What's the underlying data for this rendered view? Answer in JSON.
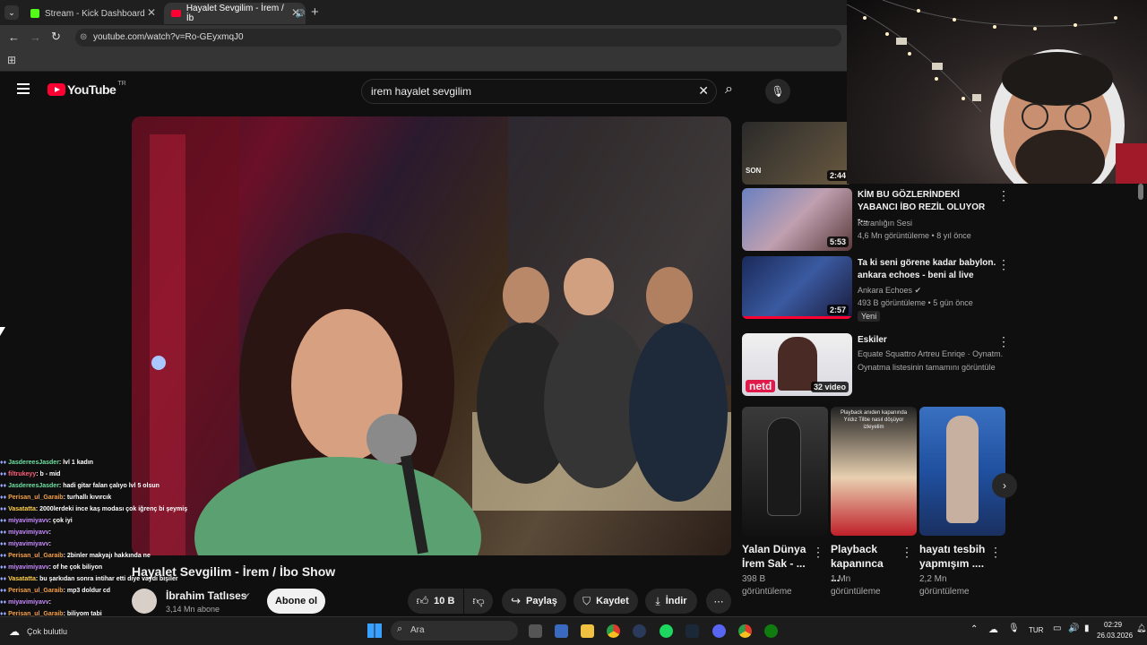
{
  "browser": {
    "tabs": [
      {
        "title": "Stream - Kick Dashboard"
      },
      {
        "title": "Hayalet Sevgilim - İrem / İb"
      }
    ],
    "url": "youtube.com/watch?v=Ro-GEyxmqJ0"
  },
  "youtube": {
    "logo": "YouTube",
    "region": "TR",
    "search_value": "irem hayalet sevgilim"
  },
  "video": {
    "title": "Hayalet Sevgilim - İrem / İbo Show",
    "channel": "İbrahim Tatlıses",
    "subscribers": "3,14 Mn abone",
    "subscribe_label": "Abone ol",
    "likes": "10 B",
    "share_label": "Paylaş",
    "save_label": "Kaydet",
    "download_label": "İndir"
  },
  "recommendations": [
    {
      "thumb_text": "SON",
      "duration": "2:44"
    },
    {
      "title": "KİM BU GÖZLERİNDEKİ YABANCI İBO REZİL OLUYOR -...",
      "channel": "Karanlığın Sesi",
      "meta": "4,6 Mn görüntüleme • 8 yıl önce",
      "duration": "5:53"
    },
    {
      "title": "Ta ki seni görene kadar babylon. ankara echoes - beni al live",
      "channel": "Ankara Echoes",
      "meta": "493 B görüntüleme • 5 gün önce",
      "badge": "Yeni",
      "duration": "2:57"
    },
    {
      "title": "Eskiler",
      "channel": "Equate Squattro Artreu Enriqe · Oynatm...",
      "meta": "Oynatma listesinin tamamını görüntüle",
      "duration": "32 video",
      "thumb_text": "netd"
    }
  ],
  "shorts": [
    {
      "title": "Yalan Dünya İrem Sak - ...",
      "views": "398 B görüntüleme"
    },
    {
      "title": "Playback kapanınca ...",
      "views": "1 Mn görüntüleme",
      "thumb_text": "Playback anıden kapanında Yıldız Tilbe nasıl döşüyor izleyelim"
    },
    {
      "title": "hayatı tesbih yapmışım ....",
      "views": "2,2 Mn görüntüleme"
    }
  ],
  "chat": [
    {
      "user": "JasdereesJasder",
      "msg": ": lvl 1 kadın",
      "color": "#6fe0a0"
    },
    {
      "user": "filtrukeyy",
      "msg": ": b - mid",
      "color": "#ff5d7a"
    },
    {
      "user": "JasdereesJasder",
      "msg": ": hadi gitar falan çalıyo lvl 5 olsun",
      "color": "#6fe0a0"
    },
    {
      "user": "Perisan_ul_Garaib",
      "msg": ": turhallı kıvırcık",
      "color": "#f5a04a"
    },
    {
      "user": "Vasatatta",
      "msg": ": 2000lerdeki ince kaş modası çok iğrenç bi şeymiş",
      "color": "#ffd04a"
    },
    {
      "user": "miyavimiyavv",
      "msg": ": çok iyi",
      "color": "#c78bff"
    },
    {
      "user": "miyavimiyavv",
      "msg": ": ",
      "color": "#c78bff"
    },
    {
      "user": "miyavimiyavv",
      "msg": ": ",
      "color": "#c78bff"
    },
    {
      "user": "Perisan_ul_Garaib",
      "msg": ": 2binler makyajı hakkında ne",
      "color": "#f5a04a"
    },
    {
      "user": "miyavimiyavv",
      "msg": ": of he çok biliyon",
      "color": "#c78bff"
    },
    {
      "user": "Vasatatta",
      "msg": ": bu şarkıdan sonra intihar etti diye vaydı bişiler",
      "color": "#ffd04a"
    },
    {
      "user": "Perisan_ul_Garaib",
      "msg": ": mp3 doldur cd",
      "color": "#f5a04a"
    },
    {
      "user": "miyavimiyavv",
      "msg": ": ",
      "color": "#c78bff"
    },
    {
      "user": "Perisan_ul_Garaib",
      "msg": ": biliyom tabi",
      "color": "#f5a04a"
    },
    {
      "user": "miyavimiyavv",
      "msg": ": ",
      "color": "#c78bff"
    }
  ],
  "taskbar": {
    "search_placeholder": "Ara",
    "weather": "Çok bulutlu",
    "language": "TUR",
    "time": "02:29",
    "date": "26.03.2026"
  }
}
